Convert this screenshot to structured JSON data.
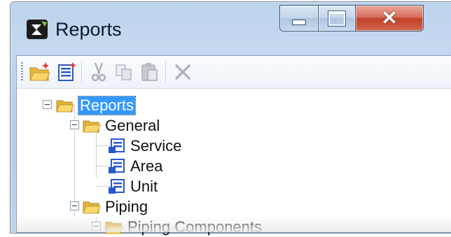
{
  "window": {
    "title": "Reports",
    "controls": {
      "minimize": "minimize",
      "maximize": "maximize",
      "close": "close"
    }
  },
  "toolbar": {
    "buttons": [
      {
        "name": "new-folder",
        "icon": "new-folder-icon",
        "enabled": true
      },
      {
        "name": "new-report",
        "icon": "new-report-icon",
        "enabled": true
      },
      {
        "name": "cut",
        "icon": "scissors-icon",
        "enabled": false
      },
      {
        "name": "copy",
        "icon": "copy-icon",
        "enabled": false
      },
      {
        "name": "paste",
        "icon": "paste-icon",
        "enabled": false
      },
      {
        "name": "delete",
        "icon": "delete-x-icon",
        "enabled": false
      }
    ]
  },
  "tree": {
    "root": {
      "label": "Reports",
      "selected": true,
      "expanded": true
    },
    "nodes": [
      {
        "label": "General",
        "type": "folder",
        "expanded": true
      },
      {
        "label": "Service",
        "type": "report"
      },
      {
        "label": "Area",
        "type": "report"
      },
      {
        "label": "Unit",
        "type": "report"
      },
      {
        "label": "Piping",
        "type": "folder",
        "expanded": true
      },
      {
        "label": "Piping Components",
        "type": "folder",
        "expanded": true
      }
    ]
  },
  "colors": {
    "selection": "#3399ff",
    "close_button": "#c24128",
    "title_bar": "#bcd3ea"
  }
}
